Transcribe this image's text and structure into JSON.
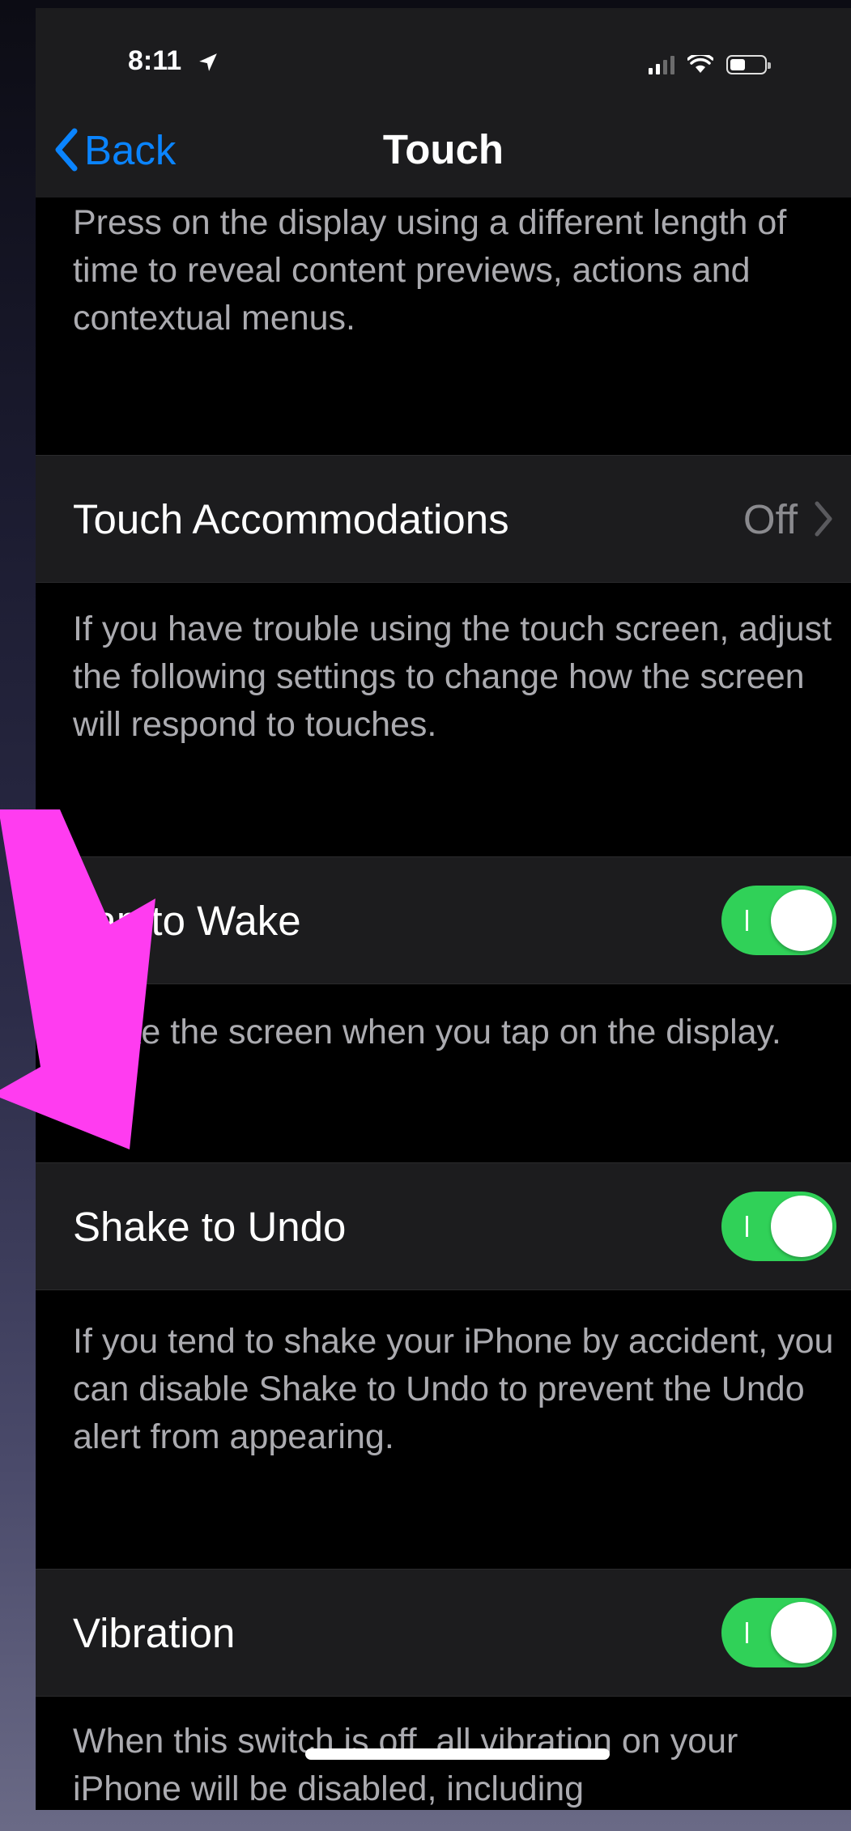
{
  "status_bar": {
    "time": "8:11",
    "location_icon": "location-arrow-icon",
    "signal_icon": "cellular-signal-icon",
    "wifi_icon": "wifi-icon",
    "battery_icon": "battery-icon"
  },
  "nav": {
    "back_label": "Back",
    "title": "Touch"
  },
  "sections": {
    "haptic_footer": "Press on the display using a different length of time to reveal content previews, actions and contextual menus.",
    "touch_accommodations": {
      "label": "Touch Accommodations",
      "value": "Off"
    },
    "touch_accommodations_footer": "If you have trouble using the touch screen, adjust the following settings to change how the screen will respond to touches.",
    "tap_to_wake": {
      "label": "Tap to Wake",
      "on": true
    },
    "tap_to_wake_footer": "Wake the screen when you tap on the display.",
    "shake_to_undo": {
      "label": "Shake to Undo",
      "on": true
    },
    "shake_to_undo_footer": "If you tend to shake your iPhone by accident, you can disable Shake to Undo to prevent the Undo alert from appearing.",
    "vibration": {
      "label": "Vibration",
      "on": true
    },
    "vibration_footer": "When this switch is off, all vibration on your iPhone will be disabled, including"
  },
  "colors": {
    "accent": "#0a84ff",
    "toggle_on": "#30d158",
    "annotation_arrow": "#ff3cf0",
    "cell_background": "#1c1c1e",
    "footer_text": "#ababb0"
  }
}
